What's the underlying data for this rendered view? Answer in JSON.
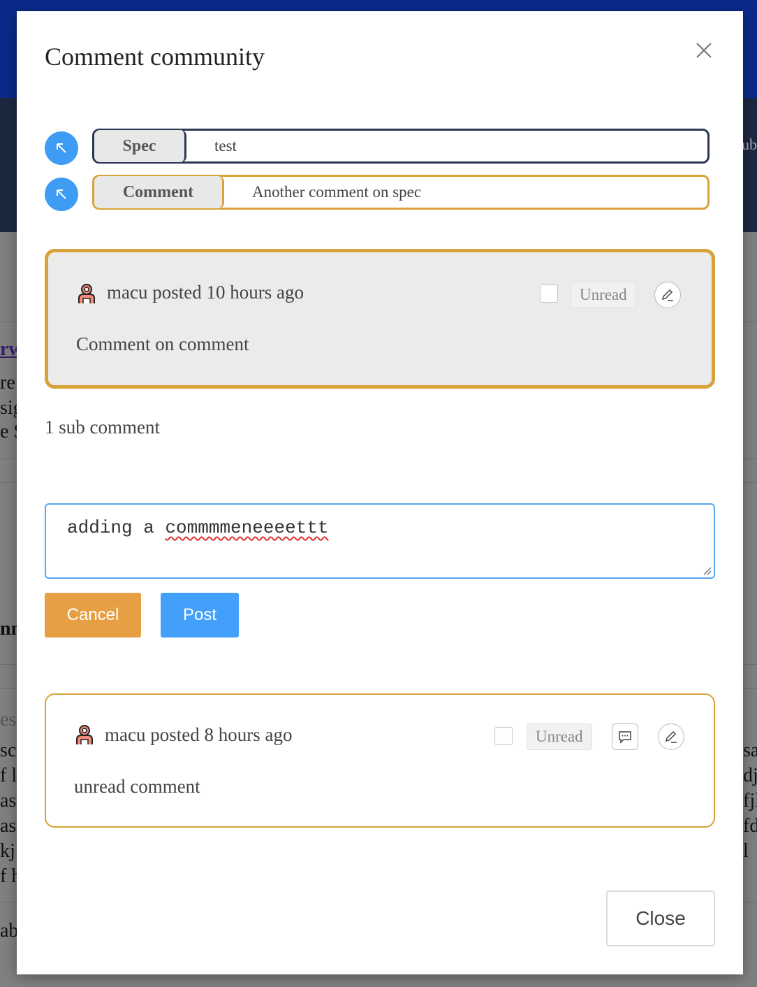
{
  "modal": {
    "title": "Comment community",
    "close_label": "Close"
  },
  "breadcrumbs": [
    {
      "tag": "Spec",
      "text": "test"
    },
    {
      "tag": "Comment",
      "text": "Another comment on spec"
    }
  ],
  "parent_comment": {
    "meta": "macu posted 10 hours ago",
    "body": "Comment on comment",
    "status": "Unread"
  },
  "sub_comment_count": "1 sub comment",
  "reply": {
    "value_prefix": "adding a ",
    "value_misspelled": "commmmeneeeettt",
    "cancel_label": "Cancel",
    "post_label": "Post"
  },
  "child_comment": {
    "meta": "macu posted 8 hours ago",
    "body": "unread comment",
    "status": "Unread"
  },
  "background_fragments": [
    "rw",
    "re",
    "sig",
    "e S",
    "nn",
    "esp",
    "sc",
    "f l",
    "asl",
    "as",
    "kj",
    "f h",
    "ab",
    "ubl",
    "sa",
    "dj",
    "fjl",
    "fd",
    "l"
  ],
  "colors": {
    "accent_blue": "#3f9cf5",
    "comment_gold": "#d8a23a",
    "spec_navy": "#2a3652",
    "cancel_orange": "#e6a043",
    "post_blue": "#42a0fb"
  },
  "icons": [
    "close-icon",
    "arrow-up-left-icon",
    "user-avatar-icon",
    "edit-pencil-icon",
    "reply-comment-icon",
    "resize-grip-icon"
  ]
}
